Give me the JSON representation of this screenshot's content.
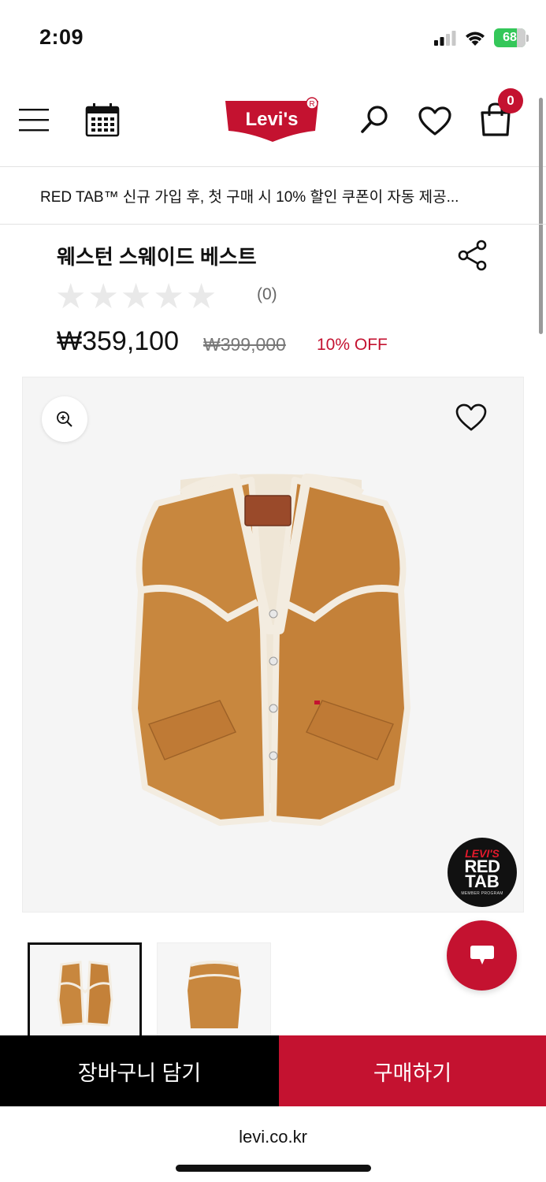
{
  "status_bar": {
    "time": "2:09",
    "battery": "68"
  },
  "header": {
    "logo": "Levi's",
    "cart_count": "0"
  },
  "promo": {
    "text": "RED TAB™ 신규 가입 후, 첫 구매 시 10% 할인 쿠폰이 자동 제공..."
  },
  "product": {
    "name": "웨스턴 스웨이드 베스트",
    "rating_stars": 0,
    "review_count": "(0)",
    "price": "₩359,100",
    "original_price": "₩399,000",
    "discount": "10% OFF"
  },
  "badge": {
    "brand": "LEVI'S",
    "line1": "RED",
    "line2": "TAB",
    "line3": "MEMBER PROGRAM"
  },
  "actions": {
    "add_to_cart": "장바구니 담기",
    "buy_now": "구매하기"
  },
  "browser": {
    "url": "levi.co.kr"
  },
  "colors": {
    "accent": "#c41230",
    "suede": "#c8873e",
    "sherpa": "#f3ece0"
  }
}
